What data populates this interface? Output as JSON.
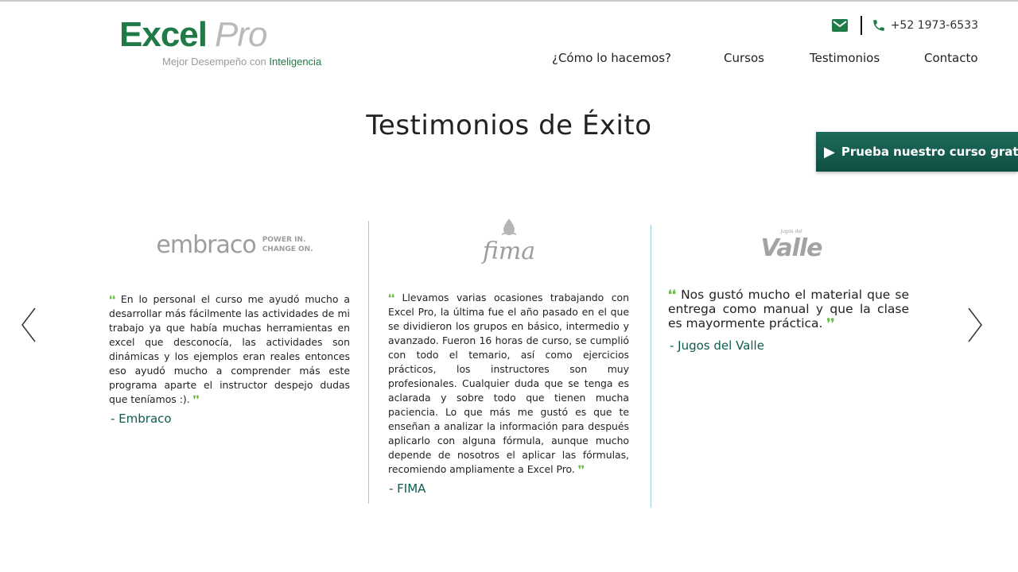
{
  "header": {
    "logo": {
      "main": "Excel",
      "pro": "Pro",
      "tagline_prefix": "Mejor Desempeño con ",
      "tagline_highlight": "Inteligencia"
    },
    "contact": {
      "mail_icon": "mail-icon",
      "phone_icon": "phone-icon",
      "phone": "+52 1973-6533"
    },
    "nav": [
      "¿Cómo lo hacemos?",
      "Cursos",
      "Testimonios",
      "Contacto"
    ]
  },
  "main": {
    "title": "Testimonios de Éxito",
    "cta": {
      "icon": "▶",
      "label": "Prueba nuestro curso gratis"
    },
    "testimonials": [
      {
        "brand": {
          "name": "embraco",
          "tagline_1": "POWER IN.",
          "tagline_2": "CHANGE ON."
        },
        "quote": "En lo personal el curso me ayudó mucho a desarrollar más fácilmente las actividades de mi trabajo ya que había muchas herramientas en excel que desconocía, las actividades son dinámicas y los ejemplos eran reales entonces eso ayudó mucho a comprender más este programa aparte el instructor despejo dudas que teníamos :).",
        "author": "- Embraco"
      },
      {
        "brand": {
          "name": "fima"
        },
        "quote": "Llevamos varias ocasiones trabajando con Excel Pro, la última fue el año pasado en el que se dividieron los grupos en básico, intermedio y avanzado. Fueron 16 horas de curso, se cumplió con todo el temario, así como ejercicios prácticos, los instructores son muy profesionales. Cualquier duda que se tenga es aclarada y sobre todo que tienen mucha paciencia. Lo que más me gustó es que te enseñan a analizar la información para después aplicarlo con alguna fórmula, aunque mucho depende de nosotros el aplicar las fórmulas, recomiendo ampliamente a Excel Pro.",
        "author": "- FIMA"
      },
      {
        "brand": {
          "name": "Valle",
          "small": "Jugos del"
        },
        "quote": "Nos gustó mucho el material que se entrega como manual y que la clase es mayormente práctica.",
        "author": "- Jugos del Valle"
      }
    ],
    "carousel": {
      "prev_icon": "chevron-left-icon",
      "next_icon": "chevron-right-icon"
    },
    "colors": {
      "brand_green": "#1f7a47",
      "cta_bg": "#0f4f43",
      "quote_mark": "#6abf4b",
      "author": "#0d5b4f",
      "divider": "#9ad0d8"
    }
  }
}
